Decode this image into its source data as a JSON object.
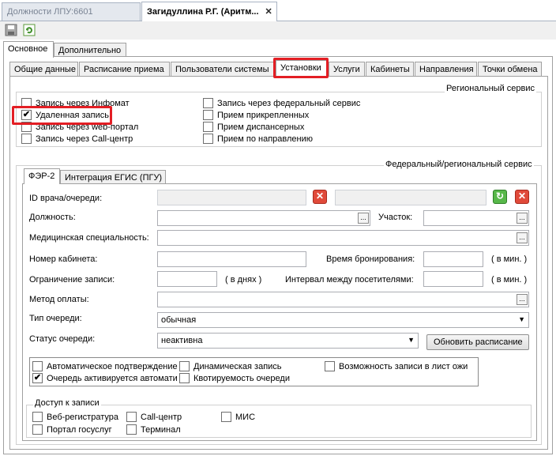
{
  "doc_tabs": [
    {
      "label": "Должности ЛПУ:6601"
    },
    {
      "label": "Загидуллина Р.Г. (Аритм..."
    }
  ],
  "close_glyph": "✕",
  "main_tabs": [
    {
      "label": "Основное"
    },
    {
      "label": "Дополнительно"
    }
  ],
  "sub_tabs": [
    {
      "label": "Общие данные"
    },
    {
      "label": "Расписание приема"
    },
    {
      "label": "Пользователи системы"
    },
    {
      "label": "Установки"
    },
    {
      "label": "Услуги"
    },
    {
      "label": "Кабинеты"
    },
    {
      "label": "Направления"
    },
    {
      "label": "Точки обмена"
    }
  ],
  "regional": {
    "title": "Региональный сервис",
    "items": [
      {
        "label": "Запись через Инфомат",
        "checked": false
      },
      {
        "label": "Удаленная запись",
        "checked": true
      },
      {
        "label": "Запись через web-портал",
        "checked": false
      },
      {
        "label": "Запись через Call-центр",
        "checked": false
      },
      {
        "label": "Запись через федеральный сервис",
        "checked": false
      },
      {
        "label": "Прием прикрепленных",
        "checked": false
      },
      {
        "label": "Прием диспансерных",
        "checked": false
      },
      {
        "label": "Прием по направлению",
        "checked": false
      }
    ]
  },
  "federal": {
    "title": "Федеральный/региональный сервис",
    "tabs": [
      {
        "label": "ФЭР-2"
      },
      {
        "label": "Интеграция ЕГИС (ПГУ)"
      }
    ],
    "fields": {
      "doctor_id": "ID врача/очереди:",
      "position": "Должность:",
      "district": "Участок:",
      "specialty": "Медицинская специальность:",
      "cabinet": "Номер кабинета:",
      "booking_time": "Время бронирования:",
      "booking_unit": "( в мин. )",
      "limit": "Ограничение записи:",
      "limit_unit": "( в днях )",
      "interval": "Интервал между посетителями:",
      "interval_unit": "( в мин. )",
      "payment": "Метод оплаты:",
      "queue_type": "Тип очереди:",
      "queue_type_value": "обычная",
      "queue_status": "Статус очереди:",
      "queue_status_value": "неактивна",
      "update_button": "Обновить расписание"
    },
    "options": [
      {
        "label": "Автоматическое подтверждение",
        "checked": false
      },
      {
        "label": "Очередь активируется автомати",
        "checked": true
      },
      {
        "label": "Динамическая запись",
        "checked": false
      },
      {
        "label": "Квотируемость очереди",
        "checked": false
      },
      {
        "label": "Возможность записи в лист ожи",
        "checked": false
      }
    ],
    "access": {
      "title": "Доступ к записи",
      "items": [
        {
          "label": "Веб-регистратура",
          "checked": false
        },
        {
          "label": "Портал госуслуг",
          "checked": false
        },
        {
          "label": "Call-центр",
          "checked": false
        },
        {
          "label": "Терминал",
          "checked": false
        },
        {
          "label": "МИС",
          "checked": false
        }
      ]
    }
  },
  "icons": {
    "save": "save-icon",
    "refresh": "refresh-icon",
    "ellipsis": "...",
    "clear": "✕",
    "refresh_glyph": "↻",
    "dropdown": "▼",
    "check": "✔"
  },
  "colors": {
    "highlight": "#e31e24"
  }
}
